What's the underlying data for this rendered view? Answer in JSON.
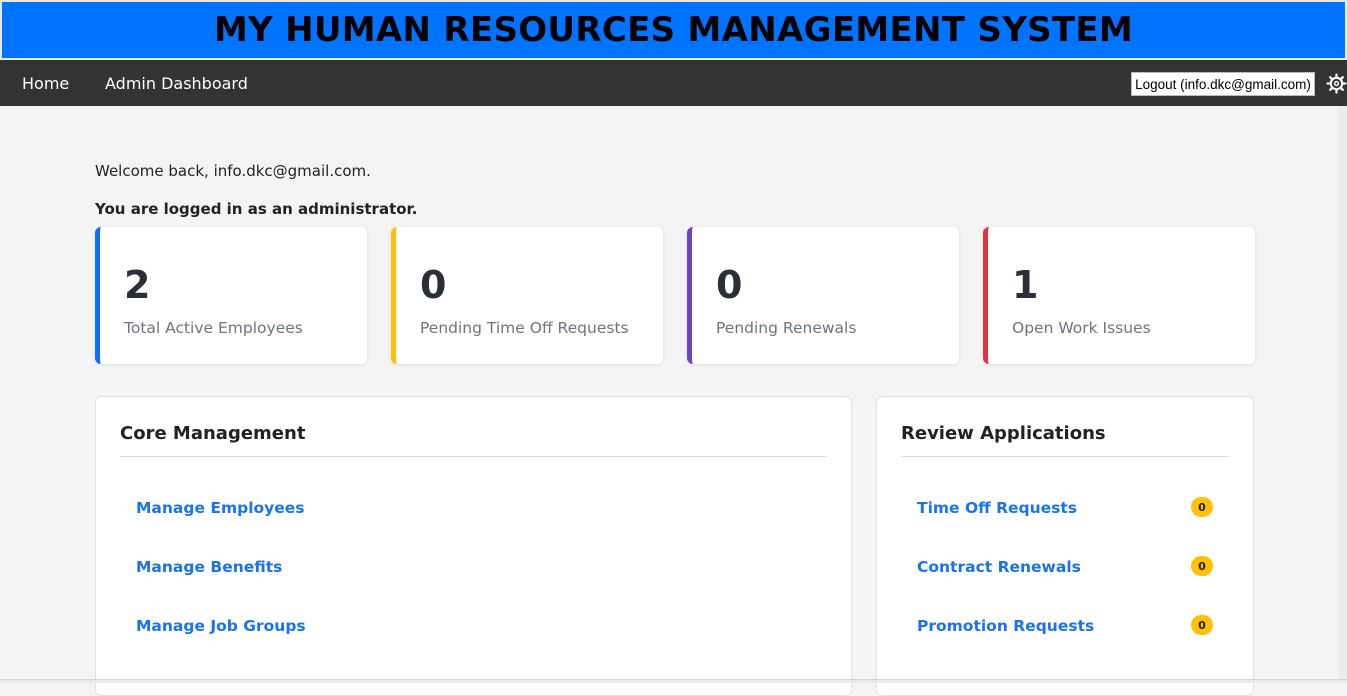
{
  "header": {
    "title": "MY HUMAN RESOURCES MANAGEMENT SYSTEM"
  },
  "nav": {
    "links": [
      {
        "label": "Home"
      },
      {
        "label": "Admin Dashboard"
      }
    ],
    "logout_label": "Logout (info.dkc@gmail.com)"
  },
  "greeting": {
    "welcome": "Welcome back, info.dkc@gmail.com.",
    "role_note": "You are logged in as an administrator."
  },
  "stats": [
    {
      "value": "2",
      "label": "Total Active Employees",
      "color": "#0d6efd"
    },
    {
      "value": "0",
      "label": "Pending Time Off Requests",
      "color": "#ffc107"
    },
    {
      "value": "0",
      "label": "Pending Renewals",
      "color": "#6f42c1"
    },
    {
      "value": "1",
      "label": "Open Work Issues",
      "color": "#dc3545"
    }
  ],
  "core_management": {
    "title": "Core Management",
    "links": [
      {
        "label": "Manage Employees"
      },
      {
        "label": "Manage Benefits"
      },
      {
        "label": "Manage Job Groups"
      }
    ]
  },
  "review_applications": {
    "title": "Review Applications",
    "items": [
      {
        "label": "Time Off Requests",
        "count": "0"
      },
      {
        "label": "Contract Renewals",
        "count": "0"
      },
      {
        "label": "Promotion Requests",
        "count": "0"
      }
    ]
  },
  "colors": {
    "banner": "#0073ff",
    "nav": "#333333",
    "link": "#1a73e8",
    "badge": "#ffc107"
  }
}
